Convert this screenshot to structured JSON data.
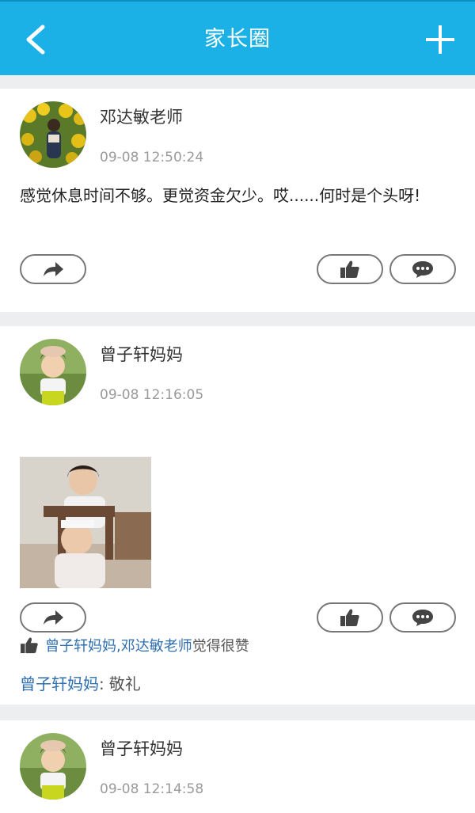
{
  "header": {
    "title": "家长圈"
  },
  "posts": [
    {
      "author": "邓达敏老师",
      "time": "09-08 12:50:24",
      "content": "感觉休息时间不够。更觉资金欠少。哎......何时是个头呀!"
    },
    {
      "author": "曾子轩妈妈",
      "time": "09-08 12:16:05",
      "likes": {
        "names": "曾子轩妈妈,邓达敏老师",
        "suffix": "觉得很赞"
      },
      "comments": [
        {
          "author": "曾子轩妈妈",
          "sep": ":",
          "text": "敬礼"
        }
      ]
    },
    {
      "author": "曾子轩妈妈",
      "time": "09-08 12:14:58"
    }
  ],
  "icons": {
    "back": "chevron-left-icon",
    "add": "plus-icon",
    "share": "share-arrow-icon",
    "like": "thumbs-up-icon",
    "comment": "speech-bubble-icon"
  },
  "colors": {
    "header": "#1cb1e6",
    "link": "#2f6fb0",
    "background": "#eceef0"
  }
}
